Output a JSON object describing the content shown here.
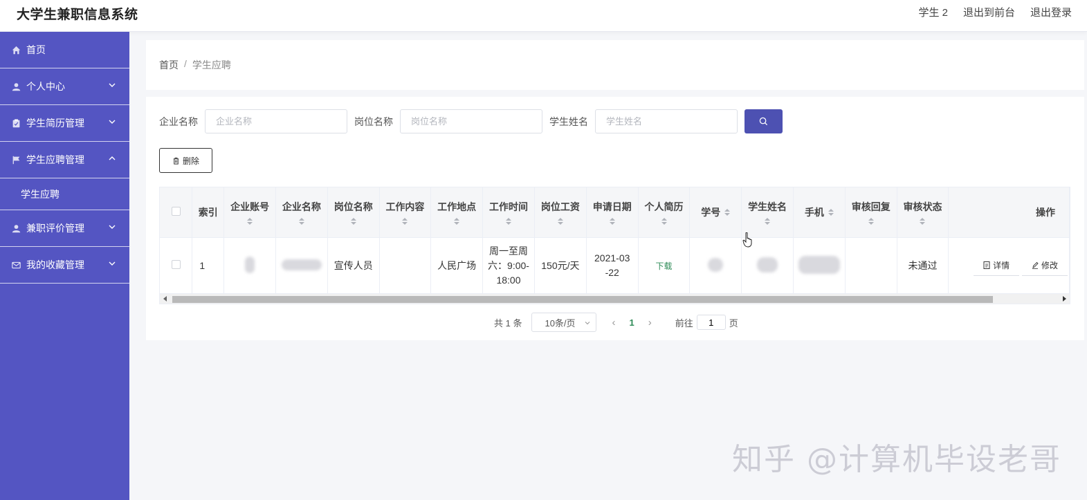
{
  "header": {
    "app_title": "大学生兼职信息系统",
    "user_label": "学生 2",
    "to_front_label": "退出到前台",
    "logout_label": "退出登录"
  },
  "sidebar": {
    "items": [
      {
        "label": "首页",
        "icon": "home-icon"
      },
      {
        "label": "个人中心",
        "icon": "user-icon"
      },
      {
        "label": "学生简历管理",
        "icon": "clipboard-icon"
      },
      {
        "label": "学生应聘管理",
        "icon": "flag-icon"
      },
      {
        "label": "学生应聘",
        "icon": ""
      },
      {
        "label": "兼职评价管理",
        "icon": "user-icon"
      },
      {
        "label": "我的收藏管理",
        "icon": "mail-icon"
      }
    ]
  },
  "breadcrumb": {
    "home": "首页",
    "sep": "/",
    "current": "学生应聘"
  },
  "search": {
    "company_label": "企业名称",
    "company_placeholder": "企业名称",
    "position_label": "岗位名称",
    "position_placeholder": "岗位名称",
    "student_label": "学生姓名",
    "student_placeholder": "学生姓名"
  },
  "toolbar": {
    "delete_label": "删除"
  },
  "table": {
    "headers": [
      "索引",
      "企业账号",
      "企业名称",
      "岗位名称",
      "工作内容",
      "工作地点",
      "工作时间",
      "岗位工资",
      "申请日期",
      "个人简历",
      "学号",
      "学生姓名",
      "手机",
      "审核回复",
      "审核状态",
      "操作"
    ],
    "rows": [
      {
        "index": "1",
        "company_account": "",
        "company_name": "",
        "position": "宣传人员",
        "work_content": "",
        "work_place": "人民广场",
        "work_time": "周一至周六：9:00-18:00",
        "salary": "150元/天",
        "apply_date": "2021-03-22",
        "resume": "下载",
        "student_no": "",
        "student_name": "",
        "phone": "",
        "review_reply": "",
        "review_status": "未通过",
        "detail_label": "详情",
        "edit_label": "修改"
      }
    ]
  },
  "pagination": {
    "total": "共 1 条",
    "page_size": "10条/页",
    "current_page": "1",
    "goto_label": "前往",
    "goto_value": "1",
    "page_unit": "页"
  },
  "watermark": "知乎 @计算机毕设老哥",
  "colors": {
    "sidebar": "#5455c2",
    "primary": "#4d51b2",
    "link": "#2e8b57"
  }
}
